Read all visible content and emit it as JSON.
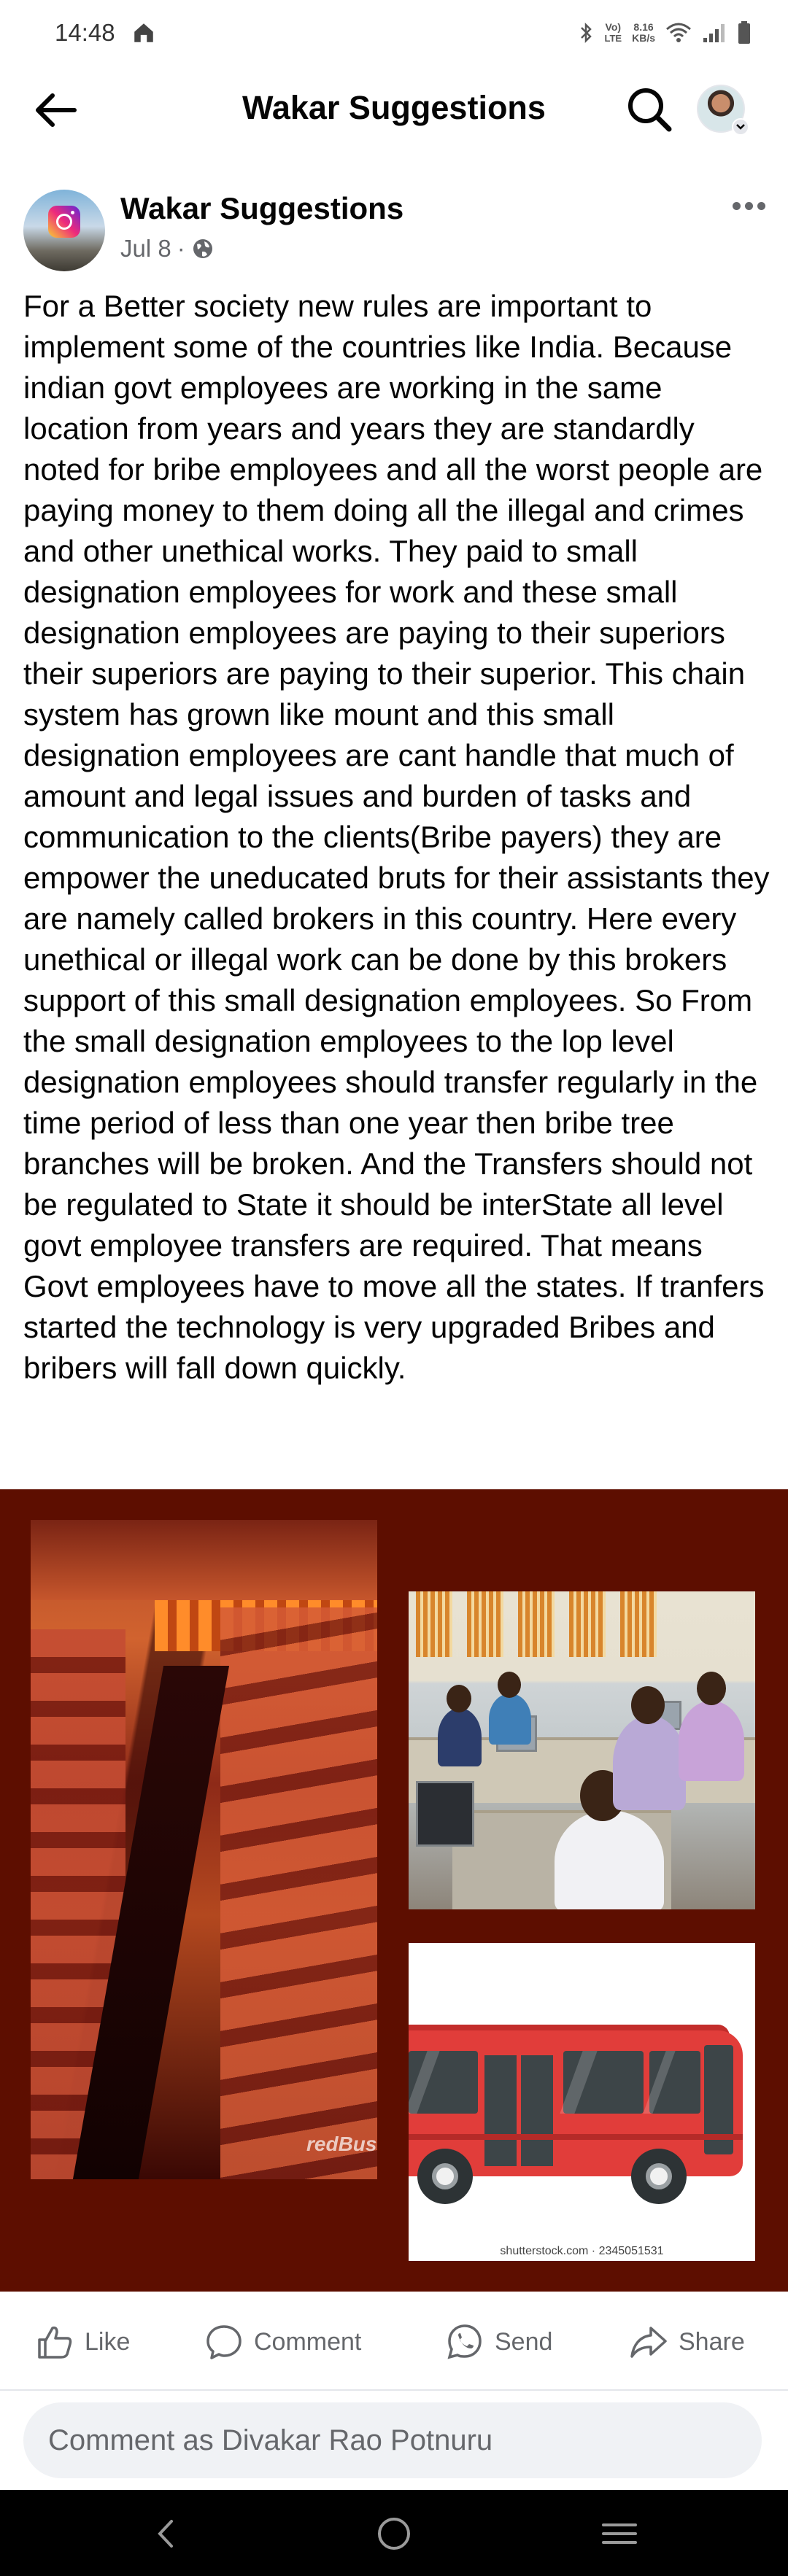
{
  "status_bar": {
    "time": "14:48",
    "network_volte_top": "Vo)",
    "network_volte_bottom": "LTE",
    "speed_value": "8.16",
    "speed_unit": "KB/s",
    "icons": [
      "home-icon",
      "bluetooth-icon",
      "wifi-icon",
      "signal-icon",
      "battery-icon"
    ]
  },
  "header": {
    "title": "Wakar Suggestions",
    "icons": [
      "back-arrow-icon",
      "search-icon",
      "profile-avatar",
      "chevron-down-icon"
    ]
  },
  "post": {
    "author": "Wakar Suggestions",
    "date": "Jul 8",
    "separator": "·",
    "audience_icon": "globe-icon",
    "body": "For a Better society new rules are important to implement some of the countries like India. Because indian govt employees are working in the same location from years and years they are standardly noted for bribe employees and all the worst people are paying money to them doing all the illegal and crimes and other unethical works. They paid to small designation employees for work and these small designation employees are paying to their superiors their superiors are paying to their superior. This chain system has grown like mount and this small designation employees are cant handle that much of amount and legal issues and burden of tasks and communication to the clients(Bribe payers) they are empower the uneducated bruts for their assistants they are namely called brokers in this country. Here every unethical or illegal work can be done by this brokers support of this small designation employees. So From the small designation employees to the lop level designation employees should transfer regularly in the time period of less than one year then bribe tree branches will be broken. And the Transfers should not be regulated to State it should be interState all level govt employee transfers are required. That means Govt employees have to move all the states. If tranfers started the technology is very upgraded Bribes and bribers will fall down quickly.",
    "media": {
      "background_color": "#5d0e00",
      "image_1_watermark": "redBus",
      "image_3_caption": "shutterstock.com · 2345051531"
    }
  },
  "actions": {
    "like": "Like",
    "comment": "Comment",
    "send": "Send",
    "share": "Share"
  },
  "comment_box": {
    "placeholder": "Comment as Divakar Rao Potnuru"
  },
  "nav": {
    "icons": [
      "nav-back-icon",
      "nav-home-icon",
      "nav-recents-icon"
    ]
  },
  "colors": {
    "text_primary": "#050505",
    "text_secondary": "#65676b",
    "divider": "#e4e6eb",
    "comment_bg": "#f0f2f5"
  }
}
